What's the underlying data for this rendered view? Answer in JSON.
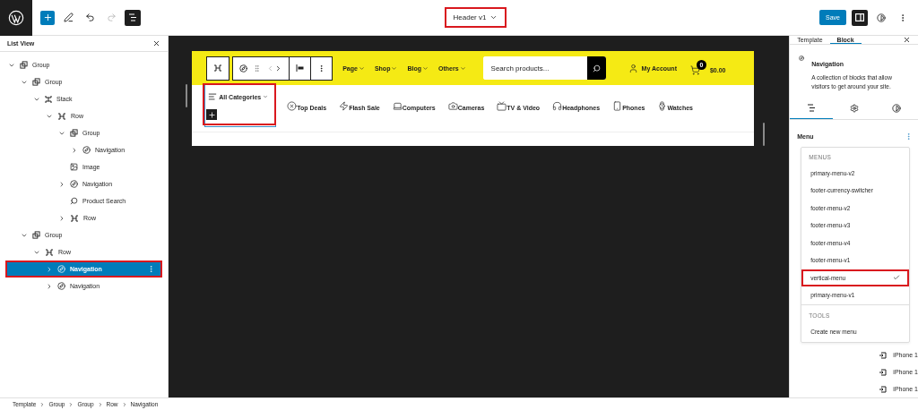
{
  "top_bar": {
    "title": "Header v1",
    "title_highlighted": true,
    "save": "Save",
    "redo_disabled": true,
    "list_view_active": true,
    "sidebar_active": true
  },
  "list_view": {
    "title": "List View",
    "items": [
      {
        "label": "Group",
        "kind": "group",
        "expanded": true,
        "selected": false,
        "highlighted": false,
        "children": [
          {
            "label": "Group",
            "kind": "group",
            "expanded": true,
            "selected": false,
            "highlighted": false,
            "children": [
              {
                "label": "Stack",
                "kind": "stack",
                "expanded": true,
                "selected": false,
                "highlighted": false,
                "children": [
                  {
                    "label": "Row",
                    "kind": "row",
                    "expanded": true,
                    "selected": false,
                    "highlighted": false,
                    "children": [
                      {
                        "label": "Group",
                        "kind": "group",
                        "expanded": true,
                        "selected": false,
                        "highlighted": false,
                        "children": [
                          {
                            "label": "Navigation",
                            "kind": "navigation",
                            "expanded": false,
                            "selected": false,
                            "highlighted": false
                          }
                        ]
                      },
                      {
                        "label": "Image",
                        "kind": "image",
                        "selected": false,
                        "highlighted": false
                      },
                      {
                        "label": "Navigation",
                        "kind": "navigation",
                        "expanded": false,
                        "selected": false,
                        "highlighted": false
                      },
                      {
                        "label": "Product Search",
                        "kind": "search",
                        "selected": false,
                        "highlighted": false
                      },
                      {
                        "label": "Row",
                        "kind": "row",
                        "expanded": false,
                        "selected": false,
                        "highlighted": false
                      }
                    ]
                  }
                ]
              }
            ]
          },
          {
            "label": "Group",
            "kind": "group",
            "expanded": true,
            "selected": false,
            "highlighted": false,
            "children": [
              {
                "label": "Row",
                "kind": "row",
                "expanded": true,
                "selected": false,
                "highlighted": false,
                "children": [
                  {
                    "label": "Navigation",
                    "kind": "navigation",
                    "expanded": false,
                    "selected": true,
                    "highlighted": true
                  },
                  {
                    "label": "Navigation",
                    "kind": "navigation",
                    "expanded": false,
                    "selected": false,
                    "highlighted": false
                  }
                ]
              }
            ]
          }
        ]
      }
    ]
  },
  "canvas": {
    "menu": [
      {
        "label": "Page"
      },
      {
        "label": "Shop"
      },
      {
        "label": "Blog"
      },
      {
        "label": "Others"
      }
    ],
    "search": {
      "placeholder": "Search products..."
    },
    "account": "My Account",
    "cart_count": "0",
    "cart_total": "$0.00",
    "all_categories": {
      "label": "All Categories",
      "highlighted": true
    },
    "categories": [
      {
        "label": "Top Deals",
        "kind": "deals"
      },
      {
        "label": "Flash Sale",
        "kind": "flash"
      },
      {
        "label": "Computers",
        "kind": "laptop"
      },
      {
        "label": "Cameras",
        "kind": "camera"
      },
      {
        "label": "TV & Video",
        "kind": "tv"
      },
      {
        "label": "Headphones",
        "kind": "headphones"
      },
      {
        "label": "Phones",
        "kind": "phone"
      },
      {
        "label": "Watches",
        "kind": "watch"
      }
    ]
  },
  "sidebar": {
    "tabs": [
      {
        "label": "Template",
        "selected": false
      },
      {
        "label": "Block",
        "selected": true
      }
    ],
    "block": {
      "title": "Navigation",
      "description": "A collection of blocks that allow visitors to get around your site."
    },
    "inspector_tabs": [
      {
        "kind": "list",
        "selected": true
      },
      {
        "kind": "settings",
        "selected": false
      },
      {
        "kind": "styles",
        "selected": false
      }
    ],
    "menu_label": "Menu",
    "dropdown": [
      {
        "heading": "MENUS",
        "items": [
          {
            "label": "primary-menu-v2",
            "checked": false,
            "highlighted": false
          },
          {
            "label": "footer-currency-switcher",
            "checked": false,
            "highlighted": false
          },
          {
            "label": "footer-menu-v2",
            "checked": false,
            "highlighted": false
          },
          {
            "label": "footer-menu-v3",
            "checked": false,
            "highlighted": false
          },
          {
            "label": "footer-menu-v4",
            "checked": false,
            "highlighted": false
          },
          {
            "label": "footer-menu-v1",
            "checked": false,
            "highlighted": false
          },
          {
            "label": "vertical-menu",
            "checked": true,
            "highlighted": true
          },
          {
            "label": "primary-menu-v1",
            "checked": false,
            "highlighted": false
          }
        ]
      },
      {
        "heading": "TOOLS",
        "items": [
          {
            "label": "Create new menu",
            "checked": false,
            "highlighted": false
          }
        ]
      }
    ],
    "submenu_items": [
      {
        "label": "iPhone 1"
      },
      {
        "label": "iPhone 1"
      },
      {
        "label": "iPhone 1"
      }
    ]
  },
  "breadcrumbs": [
    {
      "label": "Template"
    },
    {
      "label": "Group"
    },
    {
      "label": "Group"
    },
    {
      "label": "Row"
    },
    {
      "label": "Navigation"
    }
  ]
}
